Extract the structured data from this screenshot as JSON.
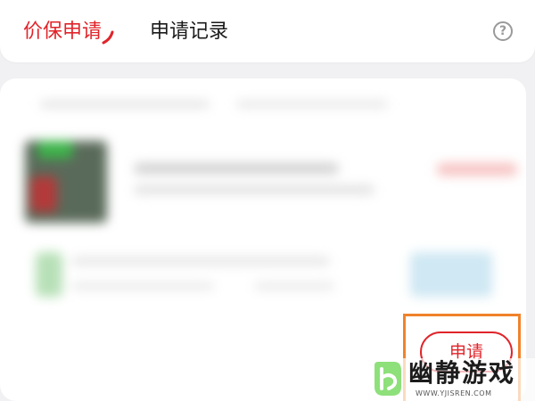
{
  "tabs": {
    "active_label": "价保申请",
    "inactive_label": "申请记录"
  },
  "help": {
    "glyph": "?"
  },
  "apply": {
    "label": "申请"
  },
  "watermark": {
    "brand": "幽静游戏",
    "url": "WWW.YJISREN.COM"
  },
  "colors": {
    "accent_red": "#e0242a",
    "highlight_orange": "#f0822b"
  }
}
